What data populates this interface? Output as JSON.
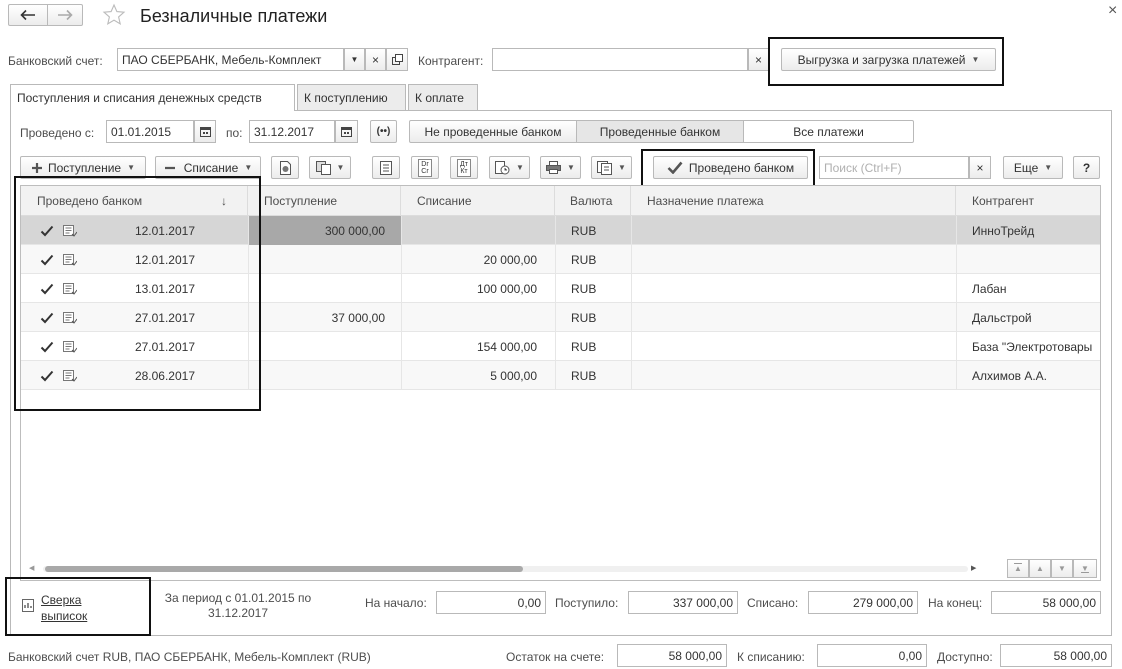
{
  "title": "Безналичные платежи",
  "close_glyph": "×",
  "account": {
    "label": "Банковский счет:",
    "value": "ПАО СБЕРБАНК, Мебель-Комплект",
    "counterparty_label": "Контрагент:",
    "counterparty_value": "",
    "export_button": "Выгрузка и загрузка платежей"
  },
  "tabs": [
    "Поступления и списания денежных средств",
    "К поступлению",
    "К оплате"
  ],
  "filter": {
    "from_label": "Проведено с:",
    "from_value": "01.01.2015",
    "to_label": "по:",
    "to_value": "31.12.2017",
    "seg1": "Не проведенные банком",
    "seg2": "Проведенные банком",
    "seg3": "Все платежи"
  },
  "toolbar": {
    "receipt": "Поступление",
    "writeoff": "Списание",
    "dr_cr_top": "Dr",
    "dr_cr_bottom": "Cr",
    "dt_kt_top": "Дт",
    "dt_kt_bottom": "Кт",
    "posted_button": "Проведено банком",
    "search_placeholder": "Поиск (Ctrl+F)",
    "more": "Еще",
    "help": "?"
  },
  "table": {
    "columns": [
      "Проведено банком",
      "Поступление",
      "Списание",
      "Валюта",
      "Назначение платежа",
      "Контрагент"
    ],
    "sort_glyph": "↓",
    "rows": [
      {
        "date": "12.01.2017",
        "in": "300 000,00",
        "out": "",
        "cur": "RUB",
        "purpose": "",
        "party": "ИнноТрейд"
      },
      {
        "date": "12.01.2017",
        "in": "",
        "out": "20 000,00",
        "cur": "RUB",
        "purpose": "",
        "party": ""
      },
      {
        "date": "13.01.2017",
        "in": "",
        "out": "100 000,00",
        "cur": "RUB",
        "purpose": "",
        "party": "Лабан"
      },
      {
        "date": "27.01.2017",
        "in": "37 000,00",
        "out": "",
        "cur": "RUB",
        "purpose": "",
        "party": "Дальстрой"
      },
      {
        "date": "27.01.2017",
        "in": "",
        "out": "154 000,00",
        "cur": "RUB",
        "purpose": "",
        "party": "База \"Электротовары"
      },
      {
        "date": "28.06.2017",
        "in": "",
        "out": "5 000,00",
        "cur": "RUB",
        "purpose": "",
        "party": "Алхимов А.А."
      }
    ]
  },
  "summary": {
    "reconcile_line1": "Сверка",
    "reconcile_line2": "выписок",
    "period_line1": "За период с 01.01.2015 по",
    "period_line2": "31.12.2017",
    "start_label": "На начало:",
    "start_value": "0,00",
    "in_label": "Поступило:",
    "in_value": "337 000,00",
    "out_label": "Списано:",
    "out_value": "279 000,00",
    "end_label": "На конец:",
    "end_value": "58 000,00"
  },
  "footer": {
    "account_text": "Банковский счет RUB, ПАО СБЕРБАНК, Мебель-Комплект (RUB)",
    "balance_label": "Остаток на счете:",
    "balance_value": "58 000,00",
    "to_write_label": "К списанию:",
    "to_write_value": "0,00",
    "available_label": "Доступно:",
    "available_value": "58 000,00"
  }
}
